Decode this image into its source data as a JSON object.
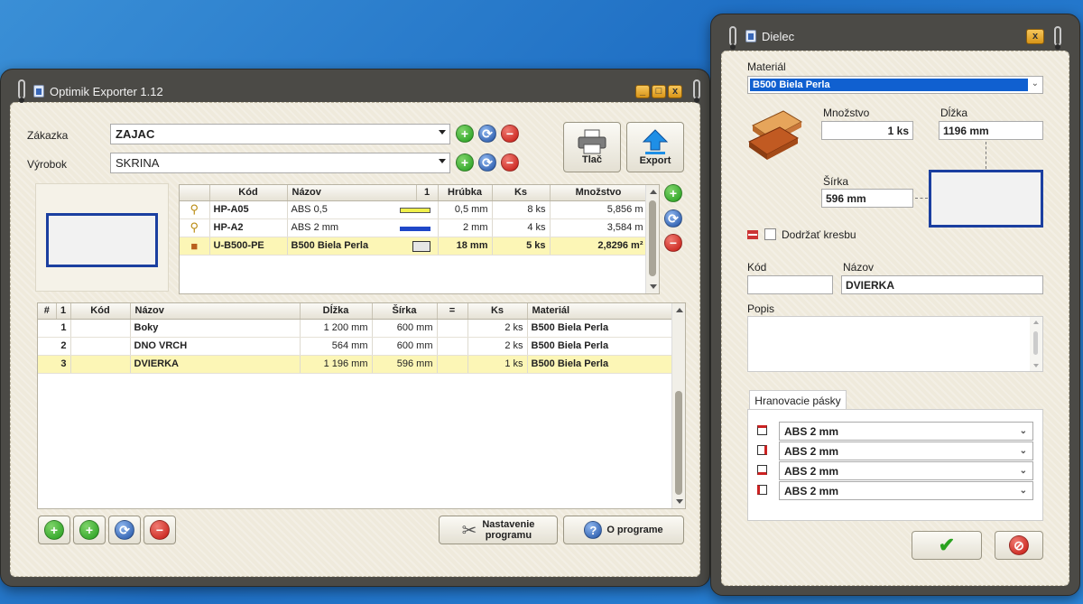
{
  "main_window": {
    "title": "Optimik Exporter 1.12",
    "zakazka_label": "Zákazka",
    "zakazka_value": "ZAJAC",
    "vyrobok_label": "Výrobok",
    "vyrobok_value": "SKRINA",
    "print_label": "Tlač",
    "export_label": "Export",
    "materials": {
      "headers": [
        "Kód",
        "Názov",
        "1",
        "Hrúbka",
        "Ks",
        "Množstvo"
      ],
      "rows": [
        {
          "kod": "HP-A05",
          "nazov": "ABS 0,5",
          "hrubka": "0,5 mm",
          "ks": "8 ks",
          "mnozstvo": "5,856 m",
          "swatch": "#f0f04a"
        },
        {
          "kod": "HP-A2",
          "nazov": "ABS 2 mm",
          "hrubka": "2 mm",
          "ks": "4 ks",
          "mnozstvo": "3,584 m",
          "swatch": "#1f47c8"
        },
        {
          "kod": "U-B500-PE",
          "nazov": "B500 Biela Perla",
          "hrubka": "18 mm",
          "ks": "5 ks",
          "mnozstvo": "2,8296 m²",
          "swatch": "#e6e6e6"
        }
      ]
    },
    "parts": {
      "headers": [
        "#",
        "1",
        "Kód",
        "Názov",
        "Dĺžka",
        "Šírka",
        "=",
        "Ks",
        "Materiál"
      ],
      "rows": [
        {
          "n": "1",
          "kod": "",
          "nazov": "Boky",
          "dlzka": "1 200 mm",
          "sirka": "600 mm",
          "eq": "",
          "ks": "2 ks",
          "material": "B500 Biela Perla"
        },
        {
          "n": "2",
          "kod": "",
          "nazov": "DNO VRCH",
          "dlzka": "564 mm",
          "sirka": "600 mm",
          "eq": "",
          "ks": "2 ks",
          "material": "B500 Biela Perla"
        },
        {
          "n": "3",
          "kod": "",
          "nazov": "DVIERKA",
          "dlzka": "1 196 mm",
          "sirka": "596 mm",
          "eq": "",
          "ks": "1 ks",
          "material": "B500 Biela Perla"
        }
      ]
    },
    "settings_label_1": "Nastavenie",
    "settings_label_2": "programu",
    "about_label": "O programe"
  },
  "dialog": {
    "title": "Dielec",
    "material_label": "Materiál",
    "material_value": "B500 Biela Perla",
    "mnozstvo_label": "Množstvo",
    "mnozstvo_value": "1 ks",
    "dlzka_label": "Dĺžka",
    "dlzka_value": "1196 mm",
    "sirka_label": "Šírka",
    "sirka_value": "596 mm",
    "dodrzat_label": "Dodržať kresbu",
    "kod_label": "Kód",
    "kod_value": "",
    "nazov_label": "Názov",
    "nazov_value": "DVIERKA",
    "popis_label": "Popis",
    "popis_value": "",
    "edges_tab": "Hranovacie pásky",
    "edges": [
      "ABS 2 mm",
      "ABS 2 mm",
      "ABS 2 mm",
      "ABS 2 mm"
    ]
  },
  "colors": {
    "accent_green": "#219c1b",
    "accent_blue": "#1d4fa3",
    "accent_red": "#c3150e",
    "selection": "#fcf6b6",
    "frame": "#4b4a46"
  }
}
